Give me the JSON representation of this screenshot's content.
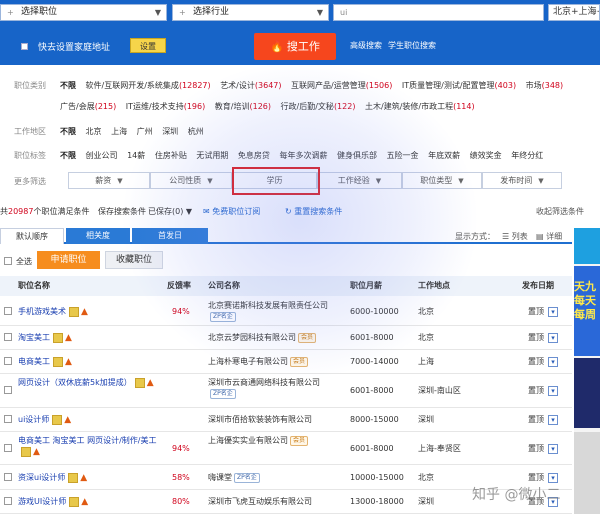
{
  "search": {
    "position_select": "选择职位",
    "industry_select": "选择行业",
    "keyword": "ui",
    "city": "北京+上海+",
    "home_label": "快去设置家庭地址",
    "settings_btn": "设置",
    "find_btn": "搜工作",
    "advanced_link": "高级搜索",
    "student_link": "学生职位搜索"
  },
  "filters": {
    "category": {
      "label": "职位类别",
      "items": [
        {
          "name": "不限",
          "count": ""
        },
        {
          "name": "软件/互联网开发/系统集成",
          "count": "(12827)"
        },
        {
          "name": "艺术/设计",
          "count": "(3647)"
        },
        {
          "name": "互联网产品/运营管理",
          "count": "(1506)"
        },
        {
          "name": "IT质量管理/测试/配置管理",
          "count": "(403)"
        },
        {
          "name": "市场",
          "count": "(348)"
        }
      ],
      "items2": [
        {
          "name": "广告/会展",
          "count": "(215)"
        },
        {
          "name": "IT运维/技术支持",
          "count": "(196)"
        },
        {
          "name": "教育/培训",
          "count": "(126)"
        },
        {
          "name": "行政/后勤/文秘",
          "count": "(122)"
        },
        {
          "name": "土木/建筑/装修/市政工程",
          "count": "(114)"
        }
      ]
    },
    "area": {
      "label": "工作地区",
      "items": [
        "不限",
        "北京",
        "上海",
        "广州",
        "深圳",
        "杭州"
      ]
    },
    "tags": {
      "label": "职位标签",
      "items": [
        "不限",
        "创业公司",
        "14薪",
        "住房补贴",
        "无试用期",
        "免息房贷",
        "每年多次调薪",
        "健身俱乐部",
        "五险一金",
        "年底双薪",
        "绩效奖金",
        "年终分红"
      ]
    },
    "more": {
      "label": "更多筛选",
      "dropdowns": [
        "薪资",
        "公司性质",
        "学历",
        "工作经验",
        "职位类型",
        "发布时间"
      ]
    }
  },
  "results": {
    "count_prefix": "共",
    "count": "20987",
    "count_suffix": "个职位满足条件",
    "save_search": "保存搜索条件",
    "saved": "已保存(0)",
    "subscribe": "免费职位订阅",
    "reset": "重置搜索条件",
    "collapse": "收起筛选条件",
    "tabs": [
      "默认顺序",
      "相关度",
      "首发日"
    ],
    "view_label": "显示方式：",
    "view_list": "列表",
    "view_detail": "详细",
    "select_all": "全选",
    "apply_btn": "申请职位",
    "fav_btn": "收藏职位"
  },
  "table": {
    "headers": [
      "职位名称",
      "反馈率",
      "公司名称",
      "职位月薪",
      "工作地点",
      "发布日期"
    ],
    "rows": [
      {
        "title": "手机游戏美术",
        "rate": "94%",
        "company": "北京赛诺斯科技发展有限责任公司",
        "tag": "ZP名企",
        "salary": "6000-10000",
        "loc": "北京",
        "date": "置顶"
      },
      {
        "title": "淘宝美工",
        "rate": "",
        "company": "北京云梦园科技有限公司",
        "tag": "会员",
        "salary": "6001-8000",
        "loc": "北京",
        "date": "置顶"
      },
      {
        "title": "电商美工",
        "rate": "",
        "company": "上海朴寒电子有限公司",
        "tag": "会员",
        "salary": "7000-14000",
        "loc": "上海",
        "date": "置顶"
      },
      {
        "title": "网页设计（双休底薪5k加提成）",
        "rate": "",
        "company": "深圳市云商通网络科技有限公司",
        "tag": "ZP名企",
        "salary": "6001-8000",
        "loc": "深圳-南山区",
        "date": "置顶"
      },
      {
        "title": "ui设计师",
        "rate": "",
        "company": "深圳市佰拾软装装饰有限公司",
        "tag": "",
        "salary": "8000-15000",
        "loc": "深圳",
        "date": "置顶"
      },
      {
        "title": "电商美工 淘宝美工 网页设计/制作/美工",
        "rate": "94%",
        "company": "上海優实实业有限公司",
        "tag": "会员",
        "salary": "6001-8000",
        "loc": "上海-奉贤区",
        "date": "置顶"
      },
      {
        "title": "资深ui设计师",
        "rate": "58%",
        "company": "嗨课堂",
        "tag": "ZP名企",
        "salary": "10000-15000",
        "loc": "北京",
        "date": "置顶"
      },
      {
        "title": "游戏UI设计师",
        "rate": "80%",
        "company": "深圳市飞虎互动娱乐有限公司",
        "tag": "",
        "salary": "13000-18000",
        "loc": "深圳",
        "date": "置顶"
      }
    ]
  },
  "ad": {
    "text1": "天九",
    "text2": "每天",
    "text3": "每周"
  },
  "watermark": "知乎 @微小二",
  "colors": {
    "topbar": "#1764c8",
    "accent_orange": "#f68d1e",
    "find_red": "#f6461d",
    "highlight_red": "#e21a1a",
    "link_blue": "#1a3fb0"
  }
}
